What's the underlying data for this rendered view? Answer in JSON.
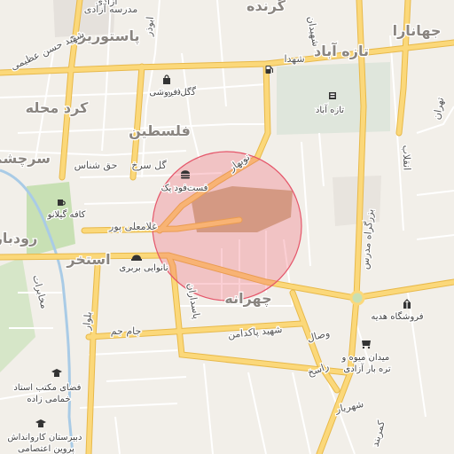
{
  "map": {
    "districts": [
      {
        "id": "jahanara",
        "text": "جهانارا"
      },
      {
        "id": "tazeh-abad-district",
        "text": "تازه آباد"
      },
      {
        "id": "pasteurizeh",
        "text": "پاستوریزه"
      },
      {
        "id": "kord-mahalleh",
        "text": "کرد محله"
      },
      {
        "id": "felestin",
        "text": "فلسطین"
      },
      {
        "id": "sarcheshmeh",
        "text": "سرچشمه"
      },
      {
        "id": "roudbar",
        "text": "رودبار"
      },
      {
        "id": "estakhr",
        "text": "استخر"
      },
      {
        "id": "chehranah",
        "text": "چهرانه"
      },
      {
        "id": "kerendeh",
        "text": "گرنده"
      }
    ],
    "streets": [
      {
        "id": "shohada",
        "text": "شهدا"
      },
      {
        "id": "gol-forushi",
        "text": "گل فروشی"
      },
      {
        "id": "hagh-shenas",
        "text": "حق شناس"
      },
      {
        "id": "gol-sorkh",
        "text": "گل سرخ"
      },
      {
        "id": "gholam-alipour",
        "text": "غلامعلی پور"
      },
      {
        "id": "jam-jam",
        "text": "جام جم"
      },
      {
        "id": "shahid-padamas",
        "text": "شهید پاکدامن"
      },
      {
        "id": "vesal",
        "text": "وصال"
      },
      {
        "id": "rasekh",
        "text": "راسخ"
      },
      {
        "id": "shahriar",
        "text": "شهریار"
      },
      {
        "id": "modares",
        "text": "بزرگراه مدرس"
      },
      {
        "id": "enghelab",
        "text": "انقلاب"
      },
      {
        "id": "azadi",
        "text": "آزادی"
      },
      {
        "id": "shahid-hasan-azimi",
        "text": "شهید حسن عظیمی"
      },
      {
        "id": "madreseh-azadi",
        "text": "مدرسه آزادی"
      },
      {
        "id": "abuzar",
        "text": "ابوذر"
      },
      {
        "id": "nobahar",
        "text": "نوبهار"
      },
      {
        "id": "tehran",
        "text": "تهران"
      },
      {
        "id": "bolvar",
        "text": "بلوار"
      },
      {
        "id": "mokhaberat",
        "text": "مخابرات"
      },
      {
        "id": "shahidan",
        "text": "شهیدان"
      },
      {
        "id": "pasdaran",
        "text": "پاسداران"
      },
      {
        "id": "kamarband",
        "text": "کمربند"
      }
    ],
    "pois": [
      {
        "id": "gol-forushi-shop",
        "icon": "shopping-bag-icon",
        "text": "گل فروشی"
      },
      {
        "id": "tazeh-abad-poi",
        "icon": "library-icon",
        "text": "تازه آباد"
      },
      {
        "id": "fast-food-yek",
        "icon": "fast-food-icon",
        "text": "فست‌فود یک"
      },
      {
        "id": "cafe-gilano",
        "icon": "cafe-icon",
        "text": "کافه گیلانو"
      },
      {
        "id": "nanvai-barbari",
        "icon": "bakery-icon",
        "text": "نانوایی بربری"
      },
      {
        "id": "forushgah-hedyeh",
        "icon": "gift-shop-icon",
        "text": "فروشگاه هدیه"
      },
      {
        "id": "meydan-miveh",
        "icon": "market-icon",
        "text": "میدان میوه و\nتره بار آزادی"
      },
      {
        "id": "makteb-khamami",
        "icon": "school-icon",
        "text": "فضای مکتب استاد\nخمامی زاده"
      },
      {
        "id": "dabirestan-karvandash",
        "icon": "school-icon",
        "text": "دبیرستان کاروانداش\nپروین اعتصامی"
      }
    ],
    "colors": {
      "background": "#f2efe9",
      "major_road": "#fbd87a",
      "major_road_casing": "#e8b94a",
      "minor_road": "#ffffff",
      "river": "#9fc5e8",
      "park": "#c8e0b4",
      "landuse_grey": "#dad6d1",
      "circle_fill": "rgba(239,83,100,0.28)",
      "circle_stroke": "#e5566a",
      "label_text": "#555555",
      "district_text": "#8a8580"
    }
  }
}
